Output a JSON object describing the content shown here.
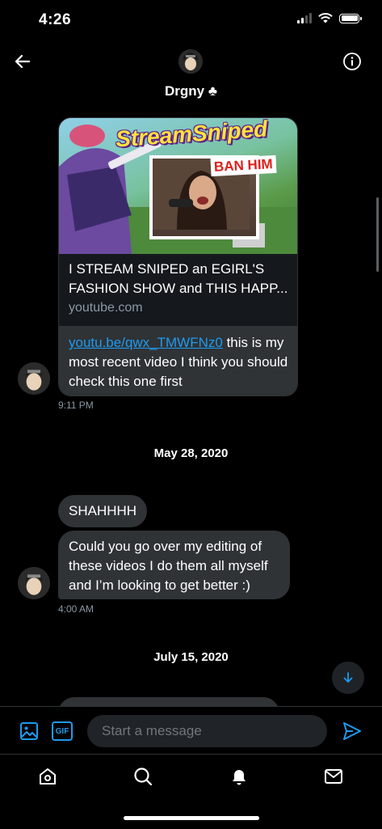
{
  "status_bar": {
    "time": "4:26"
  },
  "header": {
    "name": "Drgny ♣"
  },
  "link_card": {
    "thumbnail_title": "StreamSniped",
    "thumbnail_badge": "BAN HIM",
    "title": "I STREAM SNIPED an EGIRL'S FASHION SHOW and THIS HAPP...",
    "domain": "youtube.com",
    "message_link": "youtu.be/qwx_TMWFNz0",
    "message_text": " this is my most recent video I think you should check this one first",
    "timestamp": "9:11 PM"
  },
  "date_separators": [
    "May 28, 2020",
    "July 15, 2020"
  ],
  "messages": [
    {
      "text": "SHAHHHH"
    },
    {
      "text": "Could you go over my editing of these videos I do them all myself and I’m looking to get better :)"
    }
  ],
  "messages_timestamp": "4:00 AM",
  "composer": {
    "placeholder": "Start a message",
    "gif_label": "GIF"
  },
  "colors": {
    "accent": "#1d9bf0",
    "bubble": "#2f3336",
    "background": "#000000",
    "muted": "#8b98a5"
  }
}
